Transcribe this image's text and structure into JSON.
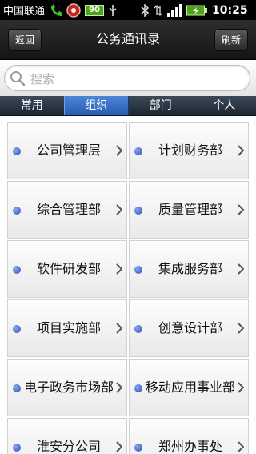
{
  "status_bar": {
    "carrier": "中国联通",
    "battery_badge": "90",
    "time": "10:25"
  },
  "header": {
    "title": "公务通讯录",
    "back_label": "返回",
    "refresh_label": "刷新"
  },
  "search": {
    "placeholder": "搜索",
    "value": ""
  },
  "tabs": [
    {
      "label": "常用",
      "active": false
    },
    {
      "label": "组织",
      "active": true
    },
    {
      "label": "部门",
      "active": false
    },
    {
      "label": "个人",
      "active": false
    }
  ],
  "departments": [
    "公司管理层",
    "计划财务部",
    "综合管理部",
    "质量管理部",
    "软件研发部",
    "集成服务部",
    "项目实施部",
    "创意设计部",
    "电子政务市场部",
    "移动应用事业部",
    "淮安分公司",
    "郑州办事处"
  ],
  "colors": {
    "accent": "#2f5fc0",
    "dot": "#3a5cc6",
    "header": "#1e1e1e"
  },
  "icons": {
    "search": "magnifier",
    "chevron": "chevron-right",
    "bullet": "blue-dot"
  }
}
